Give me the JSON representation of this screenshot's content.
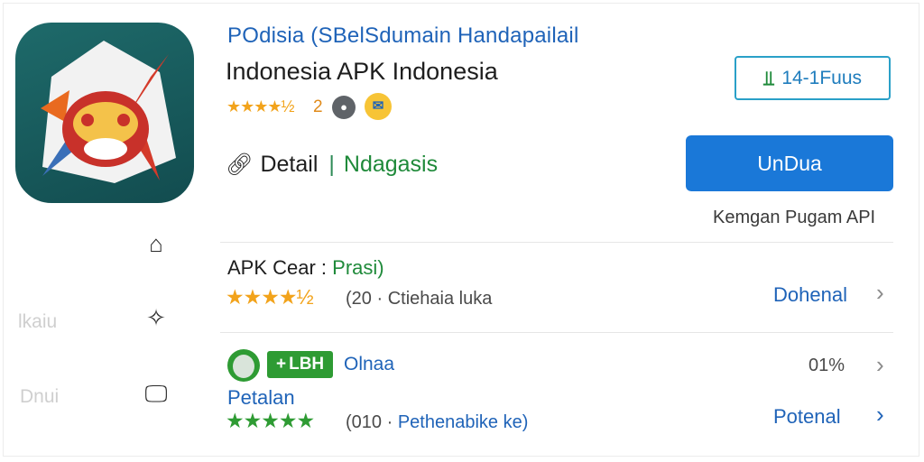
{
  "app": {
    "title_line": "POdisia (SBelSdumain Handapailail",
    "name": "Indonesia APK Indonesia",
    "rating_stars": "★★★★½",
    "rating_value": "2",
    "detail_label": "Detail",
    "category": "Ndagasis"
  },
  "actions": {
    "version_label": "14-1Fuus",
    "download_label": "UnDua",
    "api_text": "Kemgan Pugam API"
  },
  "sidebar": {
    "items": [
      {
        "icon": "home-icon",
        "glyph": "⌂"
      },
      {
        "icon": "puzzle-icon",
        "glyph": "✧"
      },
      {
        "icon": "monitor-icon",
        "glyph": "🖵"
      }
    ],
    "faded_labels": [
      "lkaiu",
      "Dnui"
    ]
  },
  "list": [
    {
      "title_prefix": "APK Cear : ",
      "title_green": "Prasi)",
      "stars": "★★★★½",
      "sub_prefix": "(20 · ",
      "sub_text": "Ctiehaia luka",
      "action": "Dohenal"
    },
    {
      "tag": "LBH",
      "tag_label": "Olnaa",
      "percent": "01%",
      "title": "Petalan",
      "stars": "★★★★★",
      "sub_prefix": "(010 · ",
      "sub_text": "Pethenabike ke)",
      "action": "Potenal"
    }
  ],
  "colors": {
    "accent_blue": "#1a78d8",
    "link_blue": "#1f63b8",
    "green": "#2e9b33",
    "star_orange": "#f2a31b"
  }
}
